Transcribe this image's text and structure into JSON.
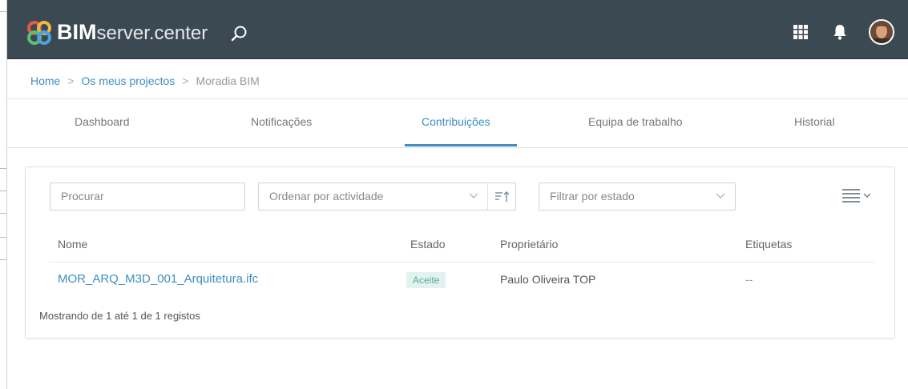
{
  "header": {
    "brand_bold": "BIM",
    "brand_light": "server.center",
    "icons": [
      "bimserver-logo-icon",
      "search-icon",
      "apps-grid-icon",
      "bell-icon",
      "user-avatar"
    ]
  },
  "breadcrumb": {
    "items": [
      "Home",
      "Os meus projectos",
      "Moradia BIM"
    ],
    "separator": ">"
  },
  "tabs": [
    {
      "label": "Dashboard"
    },
    {
      "label": "Notificações"
    },
    {
      "label": "Contribuições",
      "active": true
    },
    {
      "label": "Equipa de trabalho"
    },
    {
      "label": "Historial"
    }
  ],
  "filters": {
    "search_placeholder": "Procurar",
    "sort_value": "Ordenar por actividade",
    "status_value": "Filtrar por estado"
  },
  "table": {
    "columns": [
      "Nome",
      "Estado",
      "Proprietário",
      "Etiquetas"
    ],
    "rows": [
      {
        "nome": "MOR_ARQ_M3D_001_Arquitetura.ifc",
        "estado": "Aceite",
        "proprietario": "Paulo Oliveira TOP",
        "etiquetas": "--"
      }
    ],
    "footer": "Mostrando de 1 até 1 de 1 registos"
  },
  "colors": {
    "topbar": "#3b4952",
    "accent": "#3d8ec2",
    "badge_bg": "#e1f2ef",
    "badge_text": "#5aa898"
  }
}
